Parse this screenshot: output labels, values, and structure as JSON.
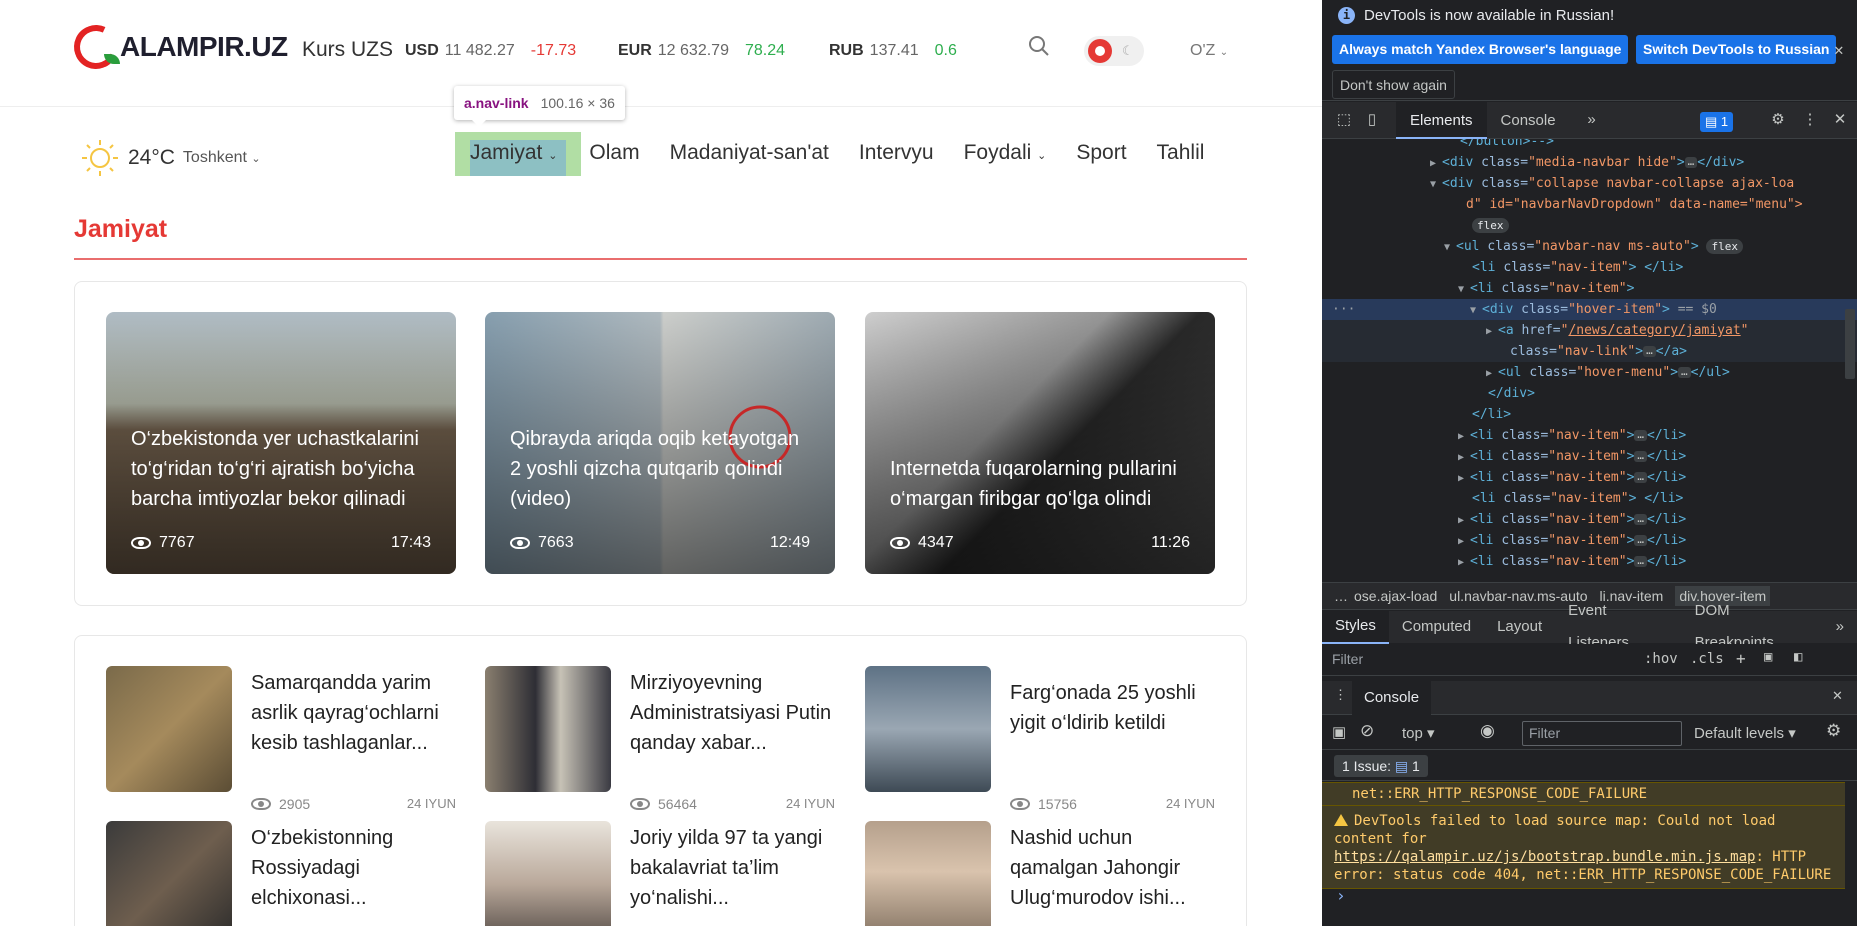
{
  "site": {
    "logo_text": "ALAMPIR.UZ",
    "kurs_label": "Kurs UZS",
    "currencies": [
      {
        "code": "USD",
        "value": "11 482.27",
        "change": "-17.73"
      },
      {
        "code": "EUR",
        "value": "12 632.79",
        "change": "78.24"
      },
      {
        "code": "RUB",
        "value": "137.41",
        "change": "0.6"
      }
    ],
    "language": "O'Z",
    "weather": {
      "temp": "24°C",
      "city": "Toshkent"
    },
    "nav": [
      "Jamiyat",
      "Olam",
      "Madaniyat-san'at",
      "Intervyu",
      "Foydali",
      "Sport",
      "Tahlil"
    ],
    "tooltip": {
      "selector": "a.nav-link",
      "size": "100.16 × 36"
    },
    "section_title": "Jamiyat",
    "featured": [
      {
        "title": "O‘zbekistonda yer uchastkalarini to‘g‘ridan to‘g‘ri ajratish bo‘yicha barcha imtiyozlar bekor qilinadi",
        "views": "7767",
        "time": "17:43"
      },
      {
        "title": "Qibrayda ariqda oqib ketayotgan 2 yoshli qizcha qutqarib qolindi (video)",
        "views": "7663",
        "time": "12:49"
      },
      {
        "title": "Internetda fuqarolarning pullarini o‘margan firibgar qo‘lga olindi",
        "views": "4347",
        "time": "11:26"
      }
    ],
    "list": [
      {
        "title": "Samarqandda yarim asrlik qayrag‘ochlarni kesib tashlaganlar...",
        "views": "2905",
        "date": "24 IYUN"
      },
      {
        "title": "Mirziyoyevning Administratsiyasi Putin qanday xabar...",
        "views": "56464",
        "date": "24 IYUN"
      },
      {
        "title": "Farg‘onada 25 yoshli yigit o‘ldirib ketildi",
        "views": "15756",
        "date": "24 IYUN"
      },
      {
        "title": "O‘zbekistonning Rossiyadagi elchixonasi...",
        "views": "",
        "date": ""
      },
      {
        "title": "Joriy yilda 97 ta yangi bakalavriat ta’lim yo‘nalishi...",
        "views": "",
        "date": ""
      },
      {
        "title": "Nashid uchun qamalgan Jahongir Ulug‘murodov ishi...",
        "views": "",
        "date": ""
      }
    ]
  },
  "devtools": {
    "info_text": "DevTools is now available in Russian!",
    "btn_match": "Always match Yandex Browser's language",
    "btn_switch": "Switch DevTools to Russian",
    "btn_dont_show": "Don't show again",
    "tabs": [
      "Elements",
      "Console"
    ],
    "issues_badge": "1",
    "tree": {
      "l0": "</button>-->",
      "l1_tag": "<div",
      "l1_attr": "class=",
      "l1_val": "\"media-navbar hide\"",
      "l1_end": "</div>",
      "l2_val": "\"collapse navbar-collapse ajax-loa",
      "l3": "d\" id=\"navbarNavDropdown\" data-name=\"menu\">",
      "pill_flex": "flex",
      "l4_val": "\"navbar-nav ms-auto\"",
      "nav_item": "\"nav-item\"",
      "hover_item": "\"hover-item\"",
      "sel_marker": "== $0",
      "href_val": "/news/category/jamiyat",
      "nav_link": "\"nav-link\"",
      "hover_menu": "\"hover-menu\""
    },
    "crumbs": [
      "…",
      "ose.ajax-load",
      "ul.navbar-nav.ms-auto",
      "li.nav-item",
      "div.hover-item"
    ],
    "styles_tabs": [
      "Styles",
      "Computed",
      "Layout",
      "Event Listeners",
      "DOM Breakpoints"
    ],
    "filter_placeholder": "Filter",
    "hov": ":hov",
    "cls": ".cls",
    "drawer_tab": "Console",
    "context": "top",
    "console_filter": "Filter",
    "levels": "Default levels",
    "issues_label": "1 Issue:",
    "issues_count": "1",
    "msg_prev": "net::ERR_HTTP_RESPONSE_CODE_FAILURE",
    "msg_warn_a": "DevTools failed to load source map: Could not load content for ",
    "msg_warn_link": "https://qalampir.uz/js/bootstrap.bundle.min.js.map",
    "msg_warn_b": ": HTTP error: status code 404, net::ERR_HTTP_RESPONSE_CODE_FAILURE"
  }
}
